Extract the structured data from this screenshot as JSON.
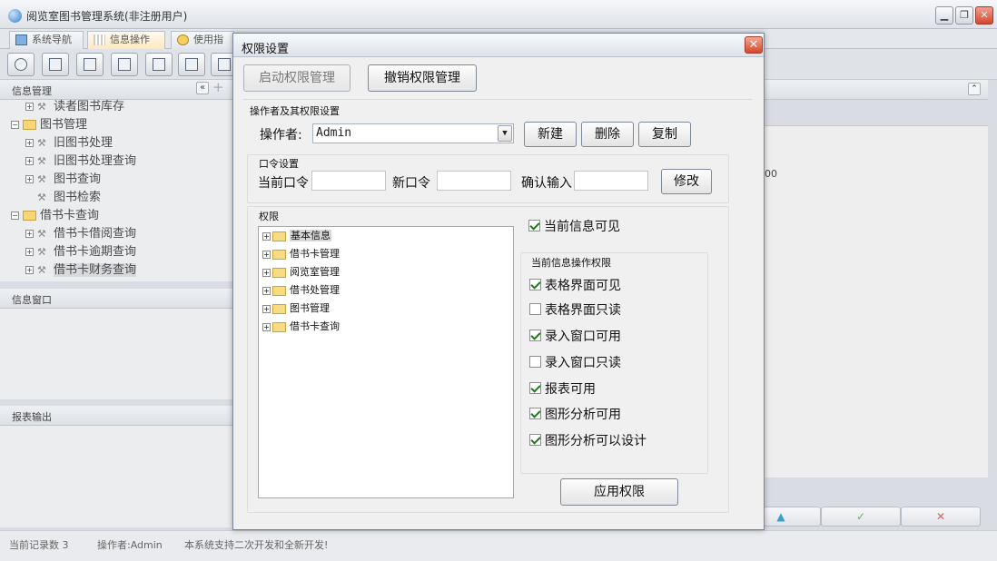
{
  "window": {
    "title": "阅览室图书管理系统(非注册用户)"
  },
  "tabs": [
    {
      "label": "系统导航"
    },
    {
      "label": "信息操作"
    },
    {
      "label": "使用指"
    }
  ],
  "left_panels": {
    "info_mgmt_title": "信息管理",
    "info_window_title": "信息窗口",
    "report_title": "报表输出"
  },
  "left_tree": [
    {
      "label": "读者图书库存",
      "level": 1
    },
    {
      "label": "图书管理",
      "level": 0
    },
    {
      "label": "旧图书处理",
      "level": 1
    },
    {
      "label": "旧图书处理查询",
      "level": 1
    },
    {
      "label": "图书查询",
      "level": 1
    },
    {
      "label": "图书检索",
      "level": 1
    },
    {
      "label": "借书卡查询",
      "level": 0
    },
    {
      "label": "借书卡借阅查询",
      "level": 1
    },
    {
      "label": "借书卡逾期查询",
      "level": 1
    },
    {
      "label": "借书卡财务查询",
      "level": 1
    }
  ],
  "right_grid_partial": "00",
  "status_bar": {
    "records": "当前记录数 3",
    "operator": "操作者:Admin",
    "notice": "本系统支持二次开发和全新开发!"
  },
  "dialog": {
    "title": "权限设置",
    "enable_btn": "启动权限管理",
    "revoke_btn": "撤销权限管理",
    "operator_group": "操作者及其权限设置",
    "operator_label": "操作者:",
    "operator_value": "Admin",
    "new_btn": "新建",
    "delete_btn": "删除",
    "copy_btn": "复制",
    "password_group": "口令设置",
    "current_pw_label": "当前口令",
    "new_pw_label": "新口令",
    "confirm_pw_label": "确认输入",
    "modify_btn": "修改",
    "permission_group": "权限",
    "perm_tree": [
      {
        "label": "基本信息"
      },
      {
        "label": "借书卡管理"
      },
      {
        "label": "阅览室管理"
      },
      {
        "label": "借书处管理"
      },
      {
        "label": "图书管理"
      },
      {
        "label": "借书卡查询"
      }
    ],
    "current_visible": {
      "label": "当前信息可见",
      "checked": true
    },
    "op_perm_group": "当前信息操作权限",
    "op_perms": [
      {
        "label": "表格界面可见",
        "checked": true
      },
      {
        "label": "表格界面只读",
        "checked": false
      },
      {
        "label": "录入窗口可用",
        "checked": true
      },
      {
        "label": "录入窗口只读",
        "checked": false
      },
      {
        "label": "报表可用",
        "checked": true
      },
      {
        "label": "图形分析可用",
        "checked": true
      },
      {
        "label": "图形分析可以设计",
        "checked": true
      }
    ],
    "apply_btn": "应用权限"
  }
}
